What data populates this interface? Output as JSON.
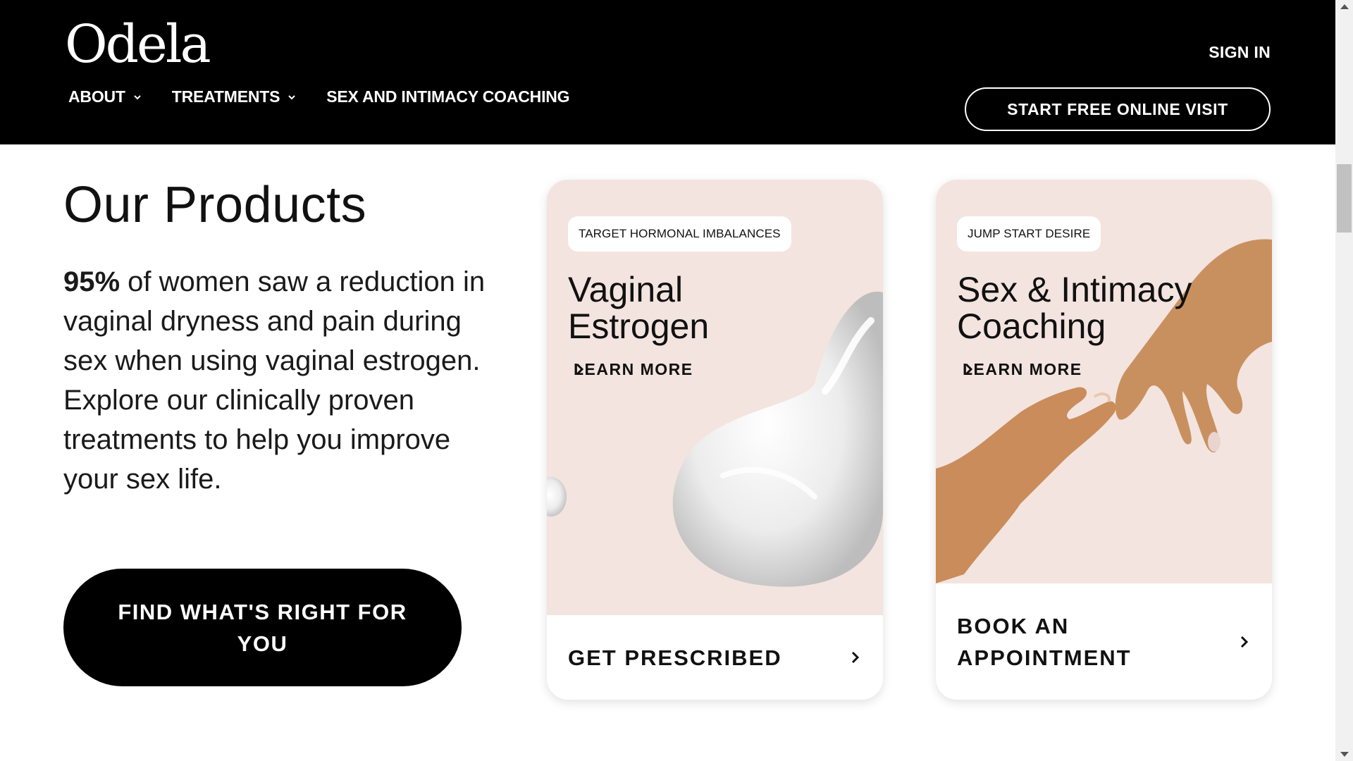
{
  "header": {
    "logo": "Odela",
    "sign_in": "SIGN IN",
    "nav": [
      {
        "label": "ABOUT",
        "has_dropdown": true
      },
      {
        "label": "TREATMENTS",
        "has_dropdown": true
      },
      {
        "label": "SEX AND INTIMACY COACHING",
        "has_dropdown": false
      }
    ],
    "cta": "START FREE ONLINE VISIT"
  },
  "main": {
    "title": "Our Products",
    "desc_bold": "95%",
    "desc_rest": " of women saw a reduction in vaginal dryness and pain during sex when using vaginal estrogen. Explore our clinically proven treatments to help you improve your sex life.",
    "cta": "FIND WHAT'S RIGHT FOR YOU"
  },
  "cards": [
    {
      "tag": "TARGET HORMONAL IMBALANCES",
      "title_line1": "Vaginal",
      "title_line2": "Estrogen",
      "learn_more": "LEARN MORE",
      "footer": "GET PRESCRIBED"
    },
    {
      "tag": "JUMP START DESIRE",
      "title_line1": "Sex & Intimacy",
      "title_line2": "Coaching",
      "learn_more": "LEARN MORE",
      "footer_line1": "BOOK AN",
      "footer_line2": "APPOINTMENT"
    }
  ],
  "colors": {
    "header_bg": "#000000",
    "card_media_bg": "#f3e4df",
    "text": "#111111"
  }
}
